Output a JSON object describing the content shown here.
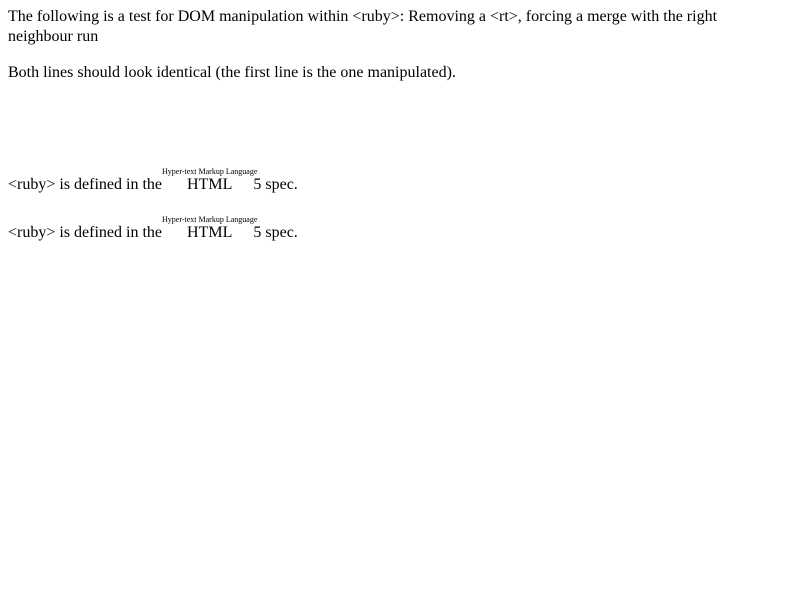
{
  "intro": "The following is a test for DOM manipulation within <ruby>: Removing a <rt>, forcing a merge with the right neighbour run",
  "note": "Both lines should look identical (the first line is the one manipulated).",
  "lines": [
    {
      "before": "<ruby> is defined in the ",
      "base": "HTML",
      "annotation": "Hyper-text Markup Language",
      "after": "5 spec."
    },
    {
      "before": "<ruby> is defined in the ",
      "base": "HTML",
      "annotation": "Hyper-text Markup Language",
      "after": "5 spec."
    }
  ]
}
